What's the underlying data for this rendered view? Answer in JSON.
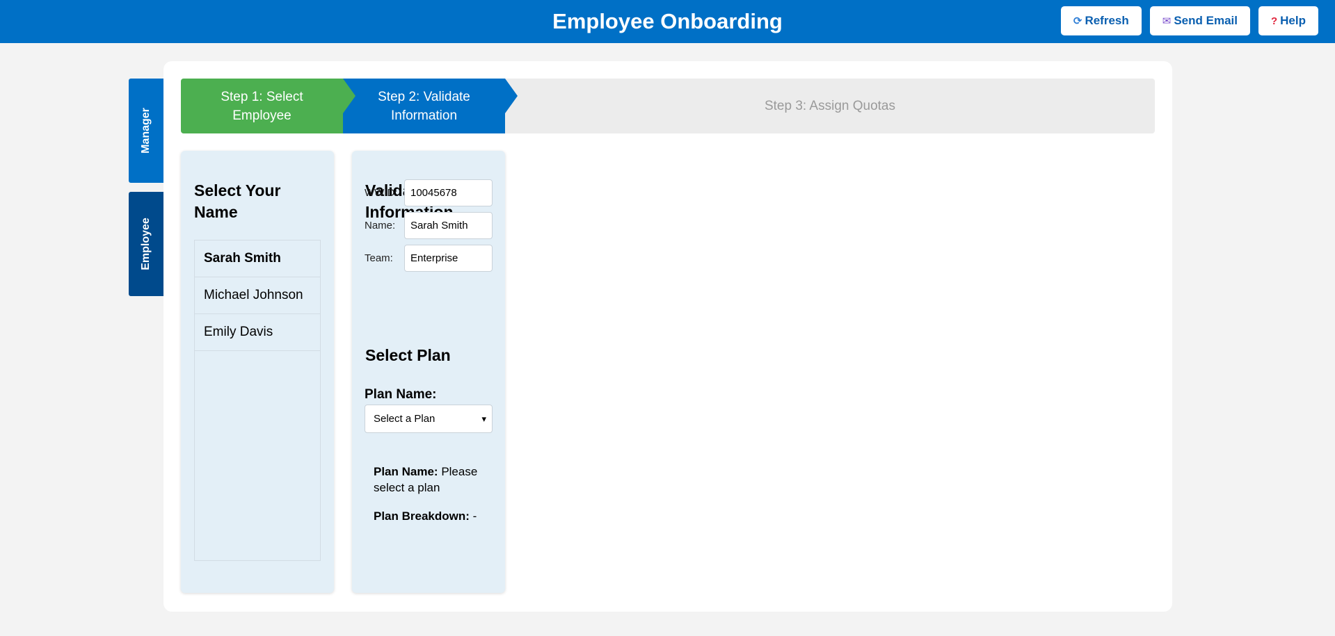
{
  "header": {
    "title": "Employee Onboarding",
    "buttons": {
      "refresh": "Refresh",
      "send_email": "Send Email",
      "help": "Help"
    }
  },
  "side_tabs": {
    "manager": "Manager",
    "employee": "Employee"
  },
  "steps": [
    {
      "label": "Step 1: Select Employee",
      "status": "complete",
      "color": "#4caf50"
    },
    {
      "label": "Step 2: Validate Information",
      "status": "active",
      "color": "#0070c6"
    },
    {
      "label": "Step 3: Assign Quotas",
      "status": "pending"
    }
  ],
  "select_name": {
    "title": "Select Your Name",
    "employees": [
      "Sarah Smith",
      "Michael Johnson",
      "Emily Davis"
    ],
    "selected": "Sarah Smith"
  },
  "validate": {
    "title": "Validate Information",
    "fields": {
      "wwid": {
        "label": "WWID:",
        "value": "10045678"
      },
      "name": {
        "label": "Name:",
        "value": "Sarah Smith"
      },
      "team": {
        "label": "Team:",
        "value": "Enterprise"
      }
    }
  },
  "plan": {
    "title": "Select Plan",
    "name_label": "Plan Name:",
    "select_value": "Select a Plan",
    "info_name_label": "Plan Name:",
    "info_name_value": "Please select a plan",
    "info_breakdown_label": "Plan Breakdown:",
    "info_breakdown_value": "-"
  },
  "colors": {
    "header_bg": "#0070c6",
    "step_complete": "#4caf50",
    "step_active": "#0070c6",
    "card_bg": "#e3eff7",
    "employee_tab": "#004a8c"
  }
}
